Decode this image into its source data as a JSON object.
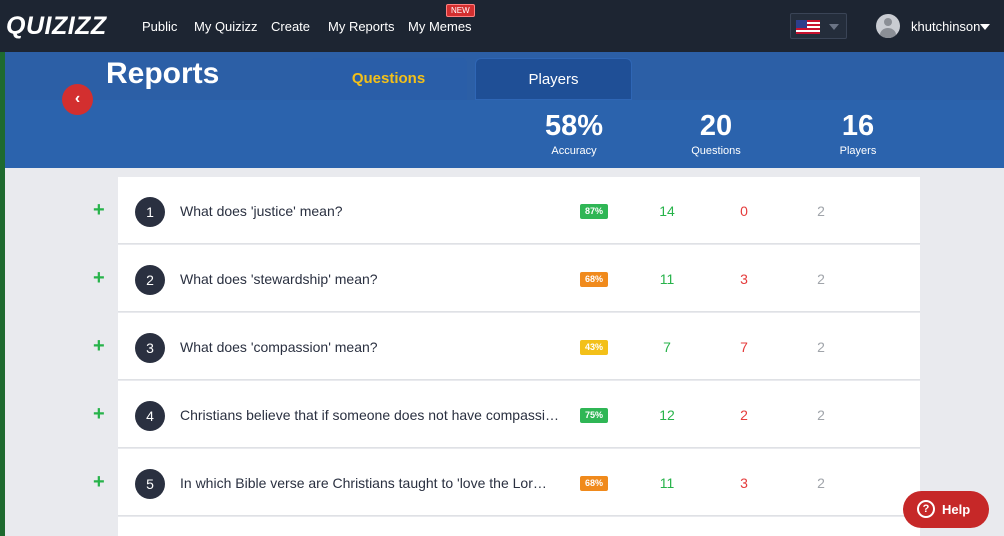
{
  "nav": {
    "logo": "QUIZIZZ",
    "links": [
      "Public",
      "My Quizizz",
      "Create",
      "My Reports",
      "My Memes"
    ],
    "new_badge": "NEW",
    "username": "khutchinson"
  },
  "header": {
    "title": "Reports",
    "tabs": [
      {
        "label": "Questions",
        "active": true
      },
      {
        "label": "Players",
        "active": false
      }
    ],
    "stats": [
      {
        "value": "58%",
        "label": "Accuracy"
      },
      {
        "value": "20",
        "label": "Questions"
      },
      {
        "value": "16",
        "label": "Players"
      }
    ]
  },
  "questions": [
    {
      "num": "1",
      "text": "What does 'justice' mean?",
      "accuracy": "87%",
      "correct": "14",
      "wrong": "0",
      "skipped": "2",
      "color": "#2fb655"
    },
    {
      "num": "2",
      "text": "What does 'stewardship' mean?",
      "accuracy": "68%",
      "correct": "11",
      "wrong": "3",
      "skipped": "2",
      "color": "#f08a1c"
    },
    {
      "num": "3",
      "text": "What does 'compassion' mean?",
      "accuracy": "43%",
      "correct": "7",
      "wrong": "7",
      "skipped": "2",
      "color": "#f3c019"
    },
    {
      "num": "4",
      "text": "Christians believe that if someone does not have compassi…",
      "accuracy": "75%",
      "correct": "12",
      "wrong": "2",
      "skipped": "2",
      "color": "#2fb655"
    },
    {
      "num": "5",
      "text": "In which Bible verse are Christians taught to 'love the Lor…",
      "accuracy": "68%",
      "correct": "11",
      "wrong": "3",
      "skipped": "2",
      "color": "#f08a1c"
    }
  ],
  "help": {
    "label": "Help",
    "icon": "?"
  }
}
